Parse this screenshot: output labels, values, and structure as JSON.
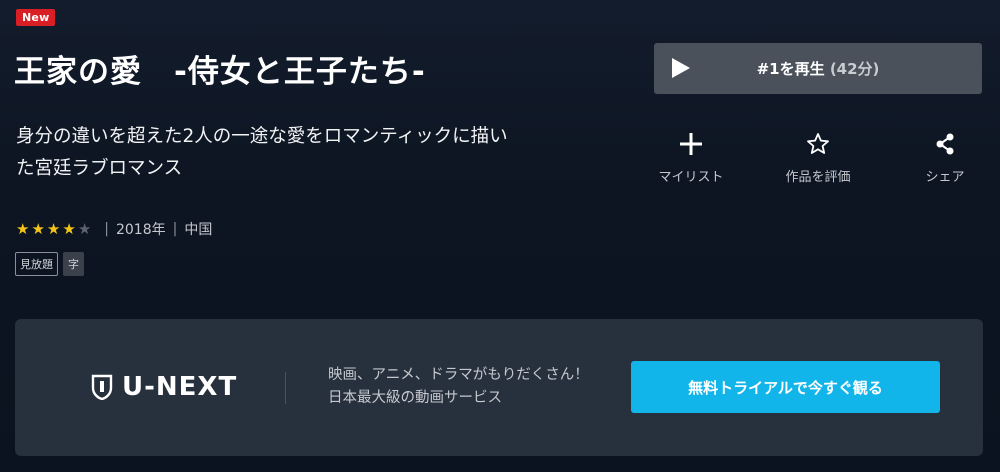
{
  "badge": {
    "new": "New"
  },
  "title": "王家の愛　-侍女と王子たち-",
  "play": {
    "label": "#1を再生",
    "duration": "(42分)"
  },
  "description": "身分の違いを超えた2人の一途な愛をロマンティックに描いた宮廷ラブロマンス",
  "actions": [
    {
      "label": "マイリスト",
      "icon": "plus-icon"
    },
    {
      "label": "作品を評価",
      "icon": "star-outline-icon"
    },
    {
      "label": "シェア",
      "icon": "share-icon"
    }
  ],
  "rating": {
    "value": 4,
    "max": 5
  },
  "meta": {
    "year": "2018年",
    "country": "中国",
    "separator": "|"
  },
  "tags": {
    "unlimited": "見放題",
    "subtitle": "字"
  },
  "banner": {
    "logo_text": "U-NEXT",
    "tagline_line1": "映画、アニメ、ドラマがもりだくさん！",
    "tagline_line2": "日本最大級の動画サービス",
    "cta_label": "無料トライアルで今すぐ観る"
  },
  "colors": {
    "accent": "#12b5ea",
    "badge_new": "#d81f26",
    "star": "#f5c518"
  }
}
